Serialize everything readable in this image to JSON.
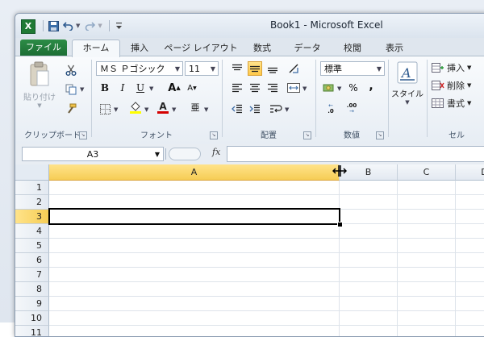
{
  "window": {
    "title": "Book1  -  Microsoft Excel"
  },
  "icons": {
    "app": "excel-icon",
    "save": "save-icon",
    "undo": "undo-icon",
    "redo": "redo-icon",
    "customize": "customize-qat-icon",
    "app_letter": "X"
  },
  "tabs": {
    "file": "ファイル",
    "items": [
      "ホーム",
      "挿入",
      "ページ レイアウト",
      "数式",
      "データ",
      "校閲",
      "表示"
    ]
  },
  "clipboard": {
    "paste_label": "貼り付け",
    "group_label": "クリップボード"
  },
  "font": {
    "name": "ＭＳ Ｐゴシック",
    "size": "11",
    "bold": "B",
    "italic": "I",
    "underline": "U",
    "grow": "A",
    "shrink": "A",
    "phonetic": "亜",
    "group_label": "フォント"
  },
  "alignment": {
    "group_label": "配置"
  },
  "number": {
    "format": "標準",
    "percent": "%",
    "comma": ",",
    "inc_decimal": ".0",
    "dec_decimal": ".00",
    "group_label": "数値"
  },
  "styles": {
    "label": "スタイル"
  },
  "cells": {
    "insert": "挿入",
    "delete": "削除",
    "format": "書式",
    "group_label": "セル"
  },
  "formula_bar": {
    "name_box": "A3",
    "fx": "fx"
  },
  "grid": {
    "columns": [
      "A",
      "B",
      "C",
      "D"
    ],
    "rows": [
      "1",
      "2",
      "3",
      "4",
      "5",
      "6",
      "7",
      "8",
      "9",
      "10",
      "11"
    ],
    "selected_cell": "A3"
  },
  "colors": {
    "accent": "#ffc94a",
    "file_tab": "#1f7a35"
  }
}
